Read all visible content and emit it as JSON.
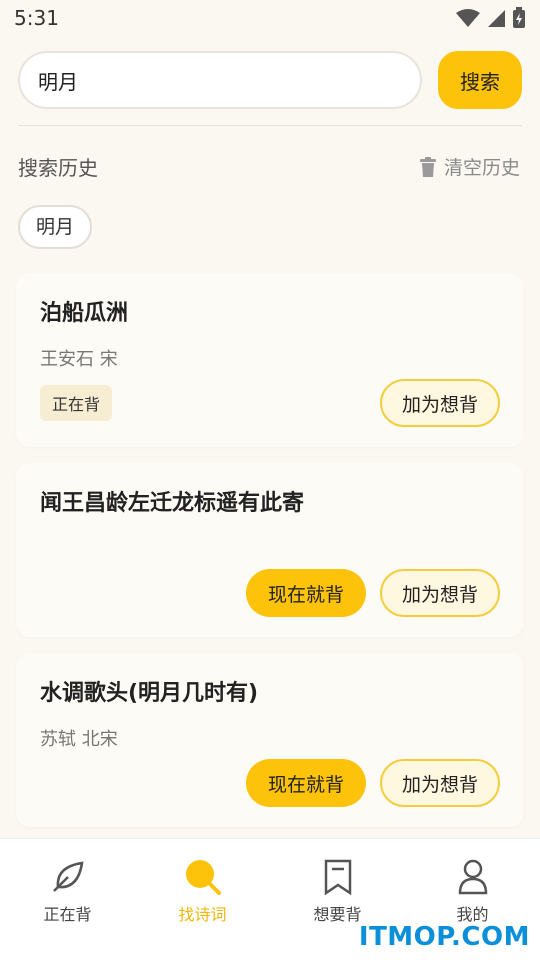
{
  "status_bar": {
    "time": "5:31"
  },
  "search": {
    "value": "明月",
    "button_label": "搜索"
  },
  "history": {
    "title": "搜索历史",
    "clear_label": "清空历史",
    "tags": [
      "明月"
    ]
  },
  "poems": [
    {
      "title": "泊船瓜洲",
      "meta": "王安石  宋",
      "status": "正在背",
      "primary_action": "",
      "secondary_action": "加为想背"
    },
    {
      "title": "闻王昌龄左迁龙标遥有此寄",
      "meta": "",
      "status": "",
      "primary_action": "现在就背",
      "secondary_action": "加为想背"
    },
    {
      "title": "水调歌头(明月几时有)",
      "meta": "苏轼  北宋",
      "status": "",
      "primary_action": "现在就背",
      "secondary_action": "加为想背"
    }
  ],
  "bottom_nav": {
    "items": [
      {
        "label": "正在背",
        "icon": "leaf-icon",
        "active": false
      },
      {
        "label": "找诗词",
        "icon": "search-icon",
        "active": true
      },
      {
        "label": "想要背",
        "icon": "bookmark-icon",
        "active": false
      },
      {
        "label": "我的",
        "icon": "person-icon",
        "active": false
      }
    ]
  },
  "watermark": "ITMOP.COM",
  "colors": {
    "accent": "#fdc20a",
    "background": "#fbf8f1",
    "watermark": "#0b8fd8"
  }
}
